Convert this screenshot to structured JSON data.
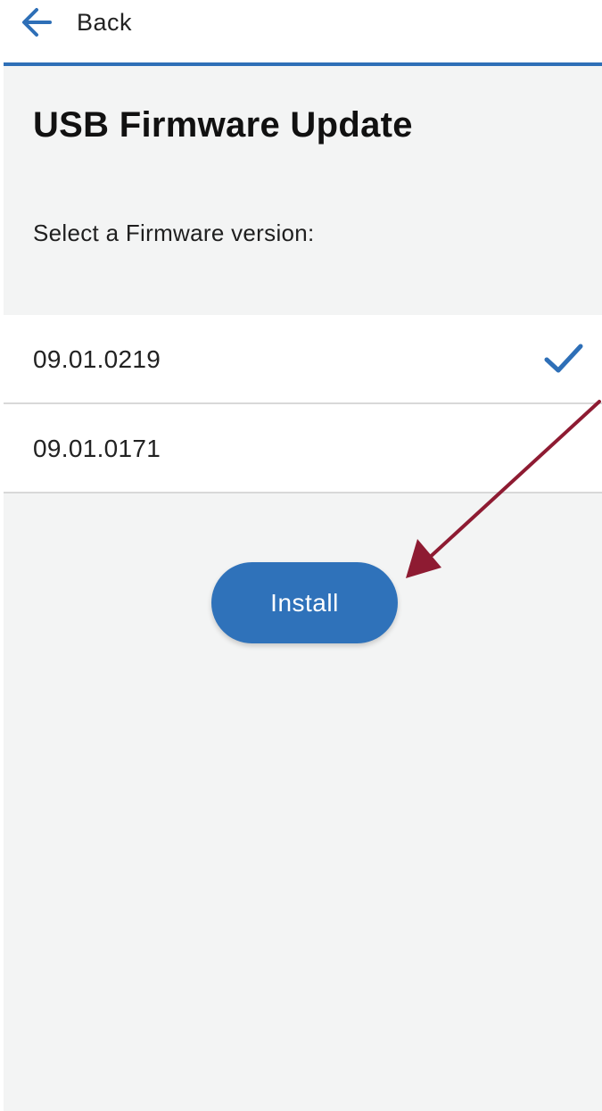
{
  "header": {
    "back_label": "Back",
    "back_icon": "arrow-left-icon"
  },
  "page": {
    "title": "USB Firmware Update",
    "prompt": "Select a Firmware version:"
  },
  "firmware_versions": [
    {
      "label": "09.01.0219",
      "selected": true
    },
    {
      "label": "09.01.0171",
      "selected": false
    }
  ],
  "install_button": {
    "label": "Install"
  },
  "colors": {
    "accent": "#2e6fb7",
    "button": "#2f72ba",
    "panel_background": "#f3f4f4",
    "annotation_arrow": "#8e1b32"
  }
}
